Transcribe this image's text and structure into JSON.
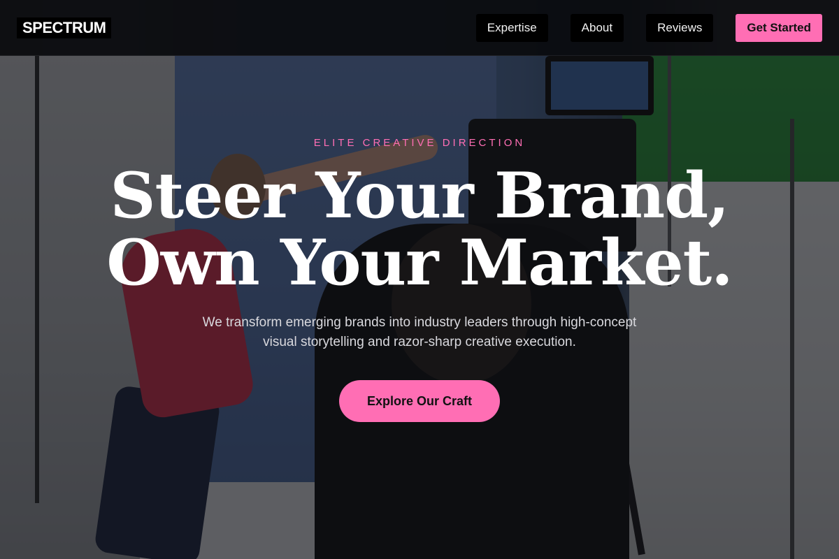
{
  "brand": {
    "logo_text": "SPECTRUM",
    "accent_color": "#ff6eb4"
  },
  "nav": {
    "links": [
      {
        "label": "Expertise"
      },
      {
        "label": "About"
      },
      {
        "label": "Reviews"
      }
    ],
    "cta_label": "Get Started"
  },
  "hero": {
    "eyebrow": "ELITE CREATIVE DIRECTION",
    "headline_line1": "Steer Your Brand,",
    "headline_line2": "Own Your Market.",
    "subtext": "We transform emerging brands into industry leaders through high-concept visual storytelling and razor-sharp creative execution.",
    "cta_label": "Explore Our Craft"
  }
}
